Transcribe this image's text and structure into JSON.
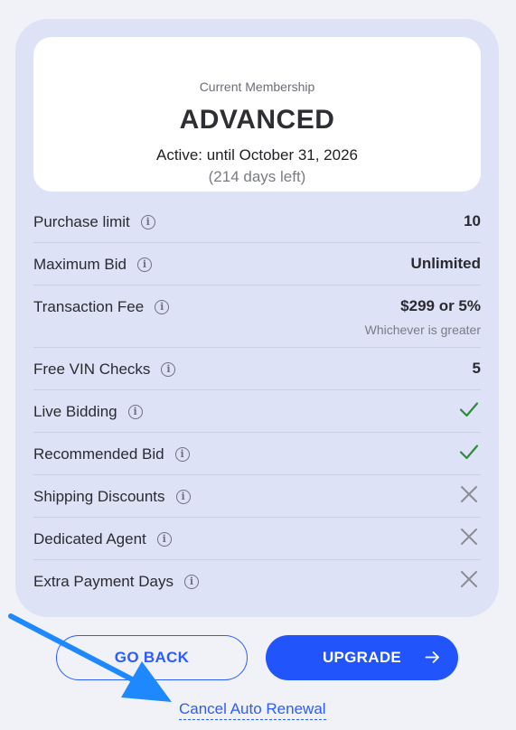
{
  "membership": {
    "label": "Current Membership",
    "tier": "ADVANCED",
    "active": "Active: until October 31, 2026",
    "days_left": "(214 days left)"
  },
  "features": [
    {
      "label": "Purchase limit",
      "value": "10",
      "kind": "text"
    },
    {
      "label": "Maximum Bid",
      "value": "Unlimited",
      "kind": "text"
    },
    {
      "label": "Transaction Fee",
      "value": "$299 or 5%",
      "sub": "Whichever is greater",
      "kind": "text"
    },
    {
      "label": "Free VIN Checks",
      "value": "5",
      "kind": "text"
    },
    {
      "label": "Live Bidding",
      "icon": "check-icon",
      "included": true
    },
    {
      "label": "Recommended Bid",
      "icon": "check-icon",
      "included": true
    },
    {
      "label": "Shipping Discounts",
      "icon": "cross-icon",
      "included": false
    },
    {
      "label": "Dedicated Agent",
      "icon": "cross-icon",
      "included": false
    },
    {
      "label": "Extra Payment Days",
      "icon": "cross-icon",
      "included": false
    }
  ],
  "info_icon_glyph": "i",
  "buttons": {
    "back_label": "GO BACK",
    "upgrade_label": "UPGRADE"
  },
  "cancel_link": "Cancel Auto Renewal",
  "colors": {
    "accent": "#2155fb",
    "card_bg": "#dde2f6",
    "check": "#2e8b3e",
    "cross": "#8a8d96",
    "annotation_arrow": "#1e88ff"
  }
}
